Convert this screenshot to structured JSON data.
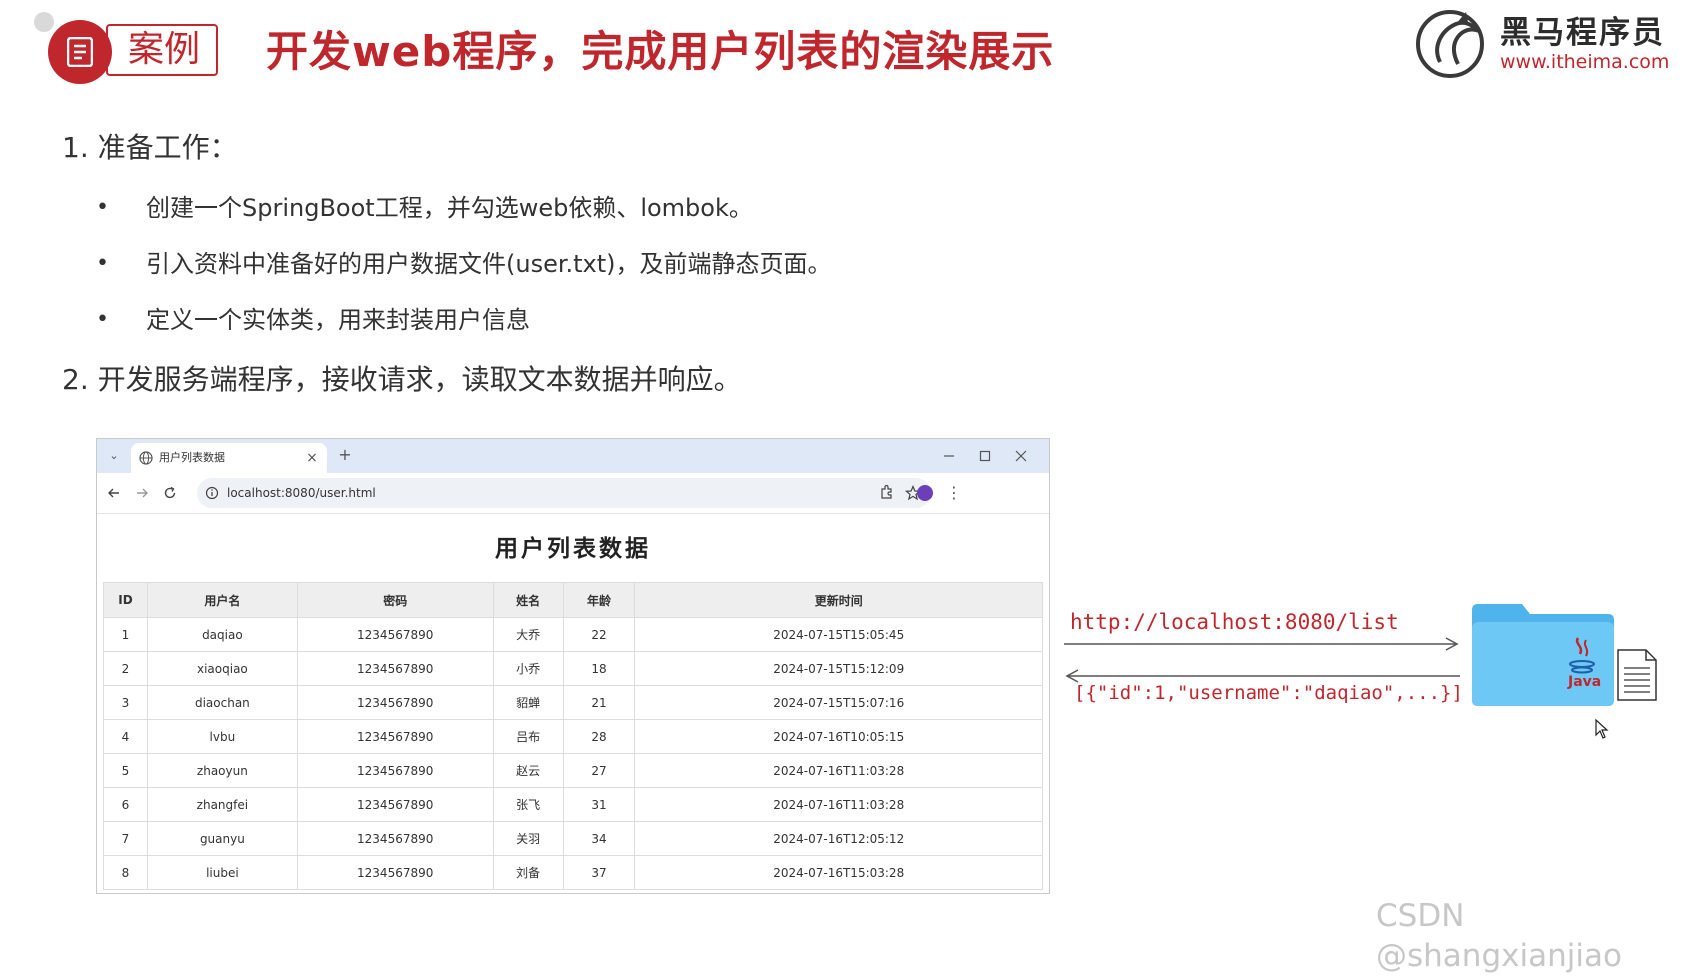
{
  "header": {
    "badge_label": "案例",
    "title": "开发web程序，完成用户列表的渲染展示",
    "logo_cn": "黑马程序员",
    "logo_url": "www.itheima.com"
  },
  "steps": [
    {
      "label": "1. 准备工作：",
      "bullets": [
        "创建一个SpringBoot工程，并勾选web依赖、lombok。",
        "引入资料中准备好的用户数据文件(user.txt)，及前端静态页面。",
        "定义一个实体类，用来封装用户信息"
      ]
    },
    {
      "label": "2. 开发服务端程序，接收请求，读取文本数据并响应。"
    }
  ],
  "browser": {
    "tab_title": "用户列表数据",
    "tab_close": "×",
    "new_tab": "+",
    "url": "localhost:8080/user.html",
    "page_heading": "用户列表数据",
    "columns": [
      "ID",
      "用户名",
      "密码",
      "姓名",
      "年龄",
      "更新时间"
    ],
    "rows": [
      [
        "1",
        "daqiao",
        "1234567890",
        "大乔",
        "22",
        "2024-07-15T15:05:45"
      ],
      [
        "2",
        "xiaoqiao",
        "1234567890",
        "小乔",
        "18",
        "2024-07-15T15:12:09"
      ],
      [
        "3",
        "diaochan",
        "1234567890",
        "貂蝉",
        "21",
        "2024-07-15T15:07:16"
      ],
      [
        "4",
        "lvbu",
        "1234567890",
        "吕布",
        "28",
        "2024-07-16T10:05:15"
      ],
      [
        "5",
        "zhaoyun",
        "1234567890",
        "赵云",
        "27",
        "2024-07-16T11:03:28"
      ],
      [
        "6",
        "zhangfei",
        "1234567890",
        "张飞",
        "31",
        "2024-07-16T11:03:28"
      ],
      [
        "7",
        "guanyu",
        "1234567890",
        "关羽",
        "34",
        "2024-07-16T12:05:12"
      ],
      [
        "8",
        "liubei",
        "1234567890",
        "刘备",
        "37",
        "2024-07-16T15:03:28"
      ]
    ]
  },
  "flow": {
    "request": "http://localhost:8080/list",
    "response": "[{\"id\":1,\"username\":\"daqiao\",...}]",
    "folder_label": "Java"
  },
  "watermark": "CSDN @shangxianjiao",
  "colors": {
    "accent": "#c0272d",
    "folder": "#5bbcf0"
  }
}
